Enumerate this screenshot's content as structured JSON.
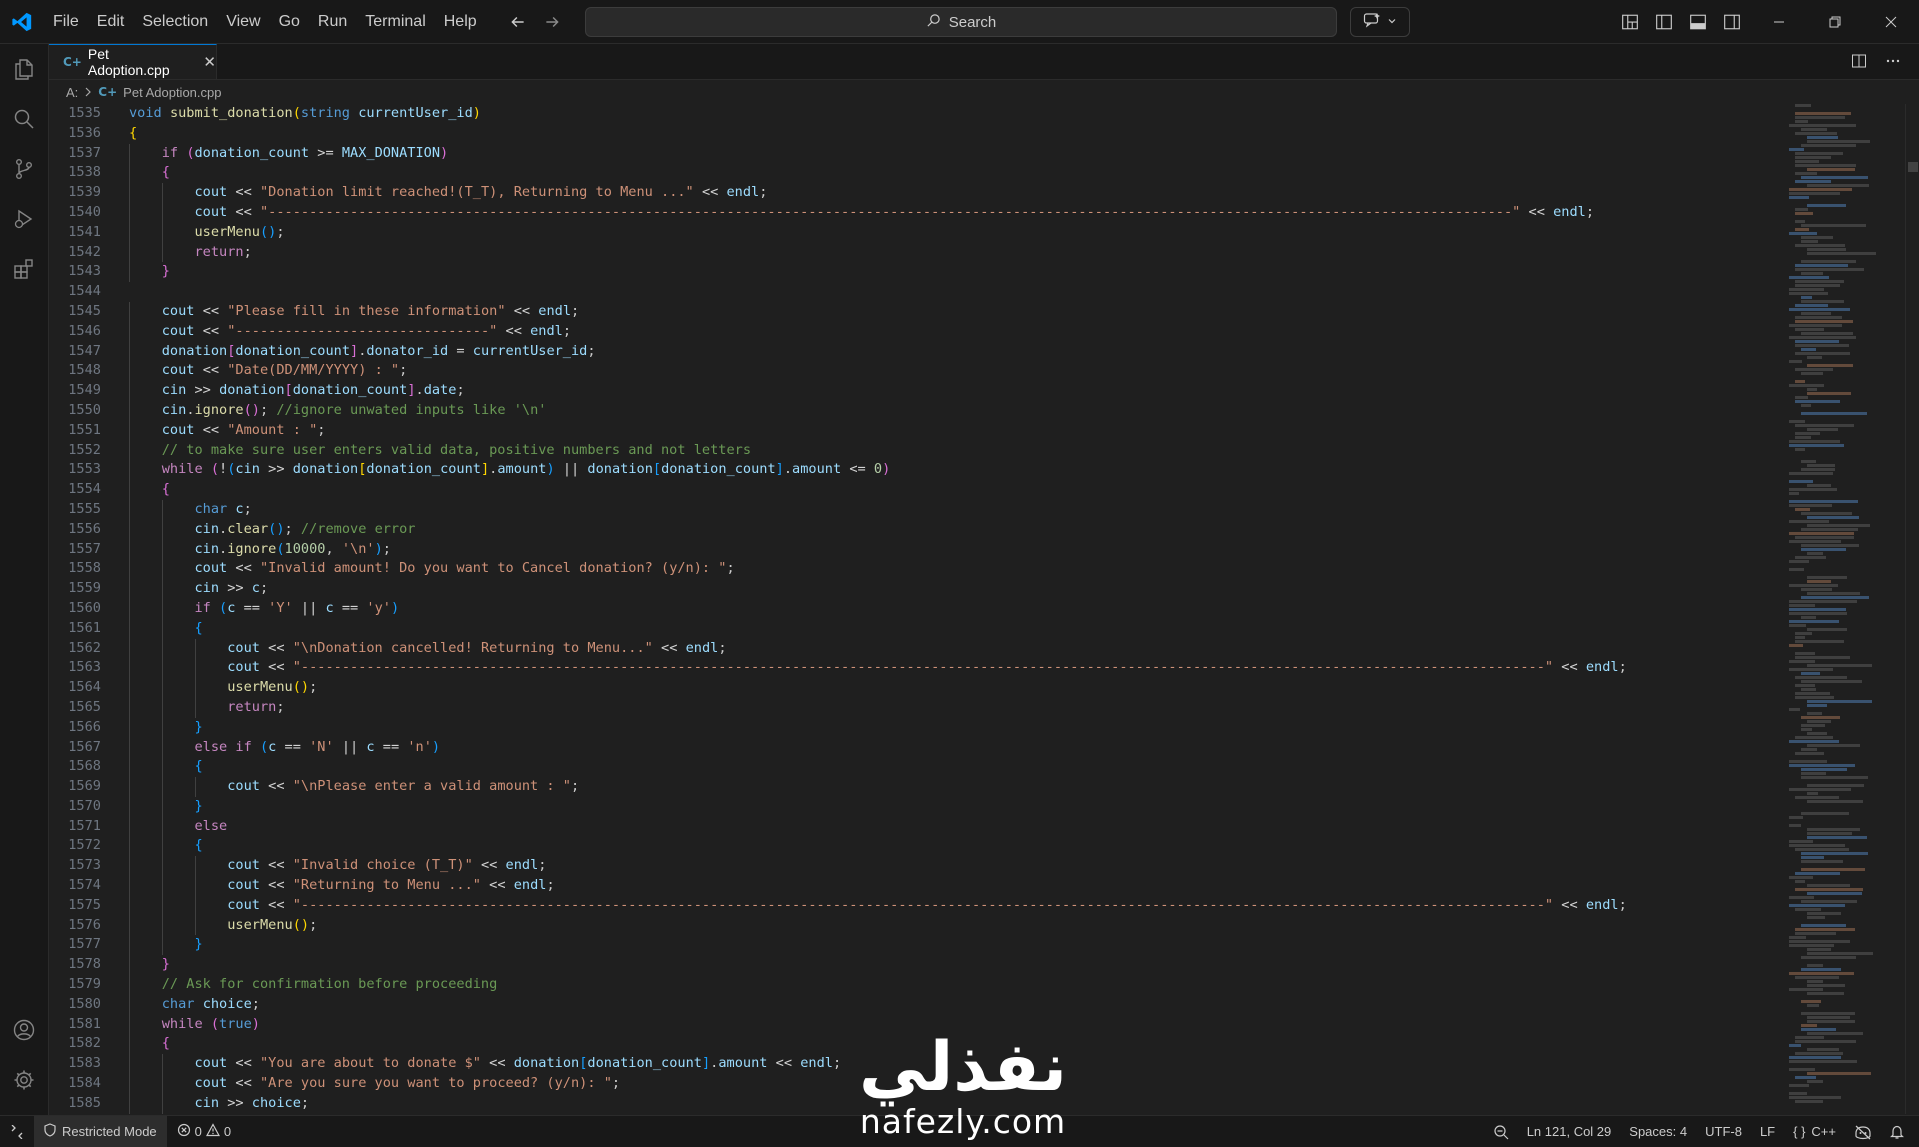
{
  "menu": [
    "File",
    "Edit",
    "Selection",
    "View",
    "Go",
    "Run",
    "Terminal",
    "Help"
  ],
  "search": {
    "label": "Search"
  },
  "tab": {
    "label": "Pet Adoption.cpp",
    "icon": "cpp-file-icon",
    "glyph": "C+"
  },
  "breadcrumb": {
    "root": "A:",
    "file": "Pet Adoption.cpp"
  },
  "colors": {
    "accent": "#0078d4",
    "editor_bg": "#1f1f1f",
    "chrome_bg": "#181818"
  },
  "code": {
    "lines": [
      {
        "n": "1535",
        "html": "<span class=\"kw\">void</span> <span class=\"fn\">submit_donation</span><span class=\"br3\">(</span><span class=\"kw\">string</span> <span class=\"var\">currentUser_id</span><span class=\"br3\">)</span>"
      },
      {
        "n": "1536",
        "html": "<span class=\"br3\">{</span>"
      },
      {
        "n": "1537",
        "html": "    <span class=\"ctl\">if</span> <span class=\"br2\">(</span><span class=\"var\">donation_count</span> <span class=\"op\">&gt;=</span> <span class=\"var\">MAX_DONATION</span><span class=\"br2\">)</span>"
      },
      {
        "n": "1538",
        "html": "    <span class=\"br2\">{</span>"
      },
      {
        "n": "1539",
        "html": "        <span class=\"var\">cout</span> <span class=\"op\">&lt;&lt;</span> <span class=\"str\">\"Donation limit reached!(T_T), Returning to Menu ...\"</span> <span class=\"op\">&lt;&lt;</span> <span class=\"var\">endl</span>;"
      },
      {
        "n": "1540",
        "html": "        <span class=\"var\">cout</span> <span class=\"op\">&lt;&lt;</span> <span class=\"str\">\"--------------------------------------------------------------------------------------------------------------------------------------------------------\"</span> <span class=\"op\">&lt;&lt;</span> <span class=\"var\">endl</span>;"
      },
      {
        "n": "1541",
        "html": "        <span class=\"fn\">userMenu</span><span class=\"br\">()</span>;"
      },
      {
        "n": "1542",
        "html": "        <span class=\"ctl\">return</span>;"
      },
      {
        "n": "1543",
        "html": "    <span class=\"br2\">}</span>"
      },
      {
        "n": "1544",
        "html": ""
      },
      {
        "n": "1545",
        "html": "    <span class=\"var\">cout</span> <span class=\"op\">&lt;&lt;</span> <span class=\"str\">\"Please fill in these information\"</span> <span class=\"op\">&lt;&lt;</span> <span class=\"var\">endl</span>;"
      },
      {
        "n": "1546",
        "html": "    <span class=\"var\">cout</span> <span class=\"op\">&lt;&lt;</span> <span class=\"str\">\"-------------------------------\"</span> <span class=\"op\">&lt;&lt;</span> <span class=\"var\">endl</span>;"
      },
      {
        "n": "1547",
        "html": "    <span class=\"var\">donation</span><span class=\"br2\">[</span><span class=\"var\">donation_count</span><span class=\"br2\">]</span>.<span class=\"var\">donator_id</span> <span class=\"op\">=</span> <span class=\"var\">currentUser_id</span>;"
      },
      {
        "n": "1548",
        "html": "    <span class=\"var\">cout</span> <span class=\"op\">&lt;&lt;</span> <span class=\"str\">\"Date(DD/MM/YYYY) : \"</span>;"
      },
      {
        "n": "1549",
        "html": "    <span class=\"var\">cin</span> <span class=\"op\">&gt;&gt;</span> <span class=\"var\">donation</span><span class=\"br2\">[</span><span class=\"var\">donation_count</span><span class=\"br2\">]</span>.<span class=\"var\">date</span>;"
      },
      {
        "n": "1550",
        "html": "    <span class=\"var\">cin</span>.<span class=\"fn\">ignore</span><span class=\"br2\">()</span>; <span class=\"cmt\">//ignore unwated inputs like '\\n'</span>"
      },
      {
        "n": "1551",
        "html": "    <span class=\"var\">cout</span> <span class=\"op\">&lt;&lt;</span> <span class=\"str\">\"Amount : \"</span>;"
      },
      {
        "n": "1552",
        "html": "    <span class=\"cmt\">// to make sure user enters valid data, positive numbers and not letters</span>"
      },
      {
        "n": "1553",
        "html": "    <span class=\"ctl\">while</span> <span class=\"br2\">(</span><span class=\"op\">!</span><span class=\"br\">(</span><span class=\"var\">cin</span> <span class=\"op\">&gt;&gt;</span> <span class=\"var\">donation</span><span class=\"br3\">[</span><span class=\"var\">donation_count</span><span class=\"br3\">]</span>.<span class=\"var\">amount</span><span class=\"br\">)</span> <span class=\"op\">||</span> <span class=\"var\">donation</span><span class=\"br\">[</span><span class=\"var\">donation_count</span><span class=\"br\">]</span>.<span class=\"var\">amount</span> <span class=\"op\">&lt;=</span> <span class=\"num\">0</span><span class=\"br2\">)</span>"
      },
      {
        "n": "1554",
        "html": "    <span class=\"br2\">{</span>"
      },
      {
        "n": "1555",
        "html": "        <span class=\"kw\">char</span> <span class=\"var\">c</span>;"
      },
      {
        "n": "1556",
        "html": "        <span class=\"var\">cin</span>.<span class=\"fn\">clear</span><span class=\"br\">()</span>; <span class=\"cmt\">//remove error</span>"
      },
      {
        "n": "1557",
        "html": "        <span class=\"var\">cin</span>.<span class=\"fn\">ignore</span><span class=\"br\">(</span><span class=\"num\">10000</span>, <span class=\"str\">'\\n'</span><span class=\"br\">)</span>;"
      },
      {
        "n": "1558",
        "html": "        <span class=\"var\">cout</span> <span class=\"op\">&lt;&lt;</span> <span class=\"str\">\"Invalid amount! Do you want to Cancel donation? (y/n): \"</span>;"
      },
      {
        "n": "1559",
        "html": "        <span class=\"var\">cin</span> <span class=\"op\">&gt;&gt;</span> <span class=\"var\">c</span>;"
      },
      {
        "n": "1560",
        "html": "        <span class=\"ctl\">if</span> <span class=\"br\">(</span><span class=\"var\">c</span> <span class=\"op\">==</span> <span class=\"str\">'Y'</span> <span class=\"op\">||</span> <span class=\"var\">c</span> <span class=\"op\">==</span> <span class=\"str\">'y'</span><span class=\"br\">)</span>"
      },
      {
        "n": "1561",
        "html": "        <span class=\"br\">{</span>"
      },
      {
        "n": "1562",
        "html": "            <span class=\"var\">cout</span> <span class=\"op\">&lt;&lt;</span> <span class=\"str\">\"\\nDonation cancelled! Returning to Menu...\"</span> <span class=\"op\">&lt;&lt;</span> <span class=\"var\">endl</span>;"
      },
      {
        "n": "1563",
        "html": "            <span class=\"var\">cout</span> <span class=\"op\">&lt;&lt;</span> <span class=\"str\">\"--------------------------------------------------------------------------------------------------------------------------------------------------------\"</span> <span class=\"op\">&lt;&lt;</span> <span class=\"var\">endl</span>;"
      },
      {
        "n": "1564",
        "html": "            <span class=\"fn\">userMenu</span><span class=\"br3\">()</span>;"
      },
      {
        "n": "1565",
        "html": "            <span class=\"ctl\">return</span>;"
      },
      {
        "n": "1566",
        "html": "        <span class=\"br\">}</span>"
      },
      {
        "n": "1567",
        "html": "        <span class=\"ctl\">else</span> <span class=\"ctl\">if</span> <span class=\"br\">(</span><span class=\"var\">c</span> <span class=\"op\">==</span> <span class=\"str\">'N'</span> <span class=\"op\">||</span> <span class=\"var\">c</span> <span class=\"op\">==</span> <span class=\"str\">'n'</span><span class=\"br\">)</span>"
      },
      {
        "n": "1568",
        "html": "        <span class=\"br\">{</span>"
      },
      {
        "n": "1569",
        "html": "            <span class=\"var\">cout</span> <span class=\"op\">&lt;&lt;</span> <span class=\"str\">\"\\nPlease enter a valid amount : \"</span>;"
      },
      {
        "n": "1570",
        "html": "        <span class=\"br\">}</span>"
      },
      {
        "n": "1571",
        "html": "        <span class=\"ctl\">else</span>"
      },
      {
        "n": "1572",
        "html": "        <span class=\"br\">{</span>"
      },
      {
        "n": "1573",
        "html": "            <span class=\"var\">cout</span> <span class=\"op\">&lt;&lt;</span> <span class=\"str\">\"Invalid choice (T_T)\"</span> <span class=\"op\">&lt;&lt;</span> <span class=\"var\">endl</span>;"
      },
      {
        "n": "1574",
        "html": "            <span class=\"var\">cout</span> <span class=\"op\">&lt;&lt;</span> <span class=\"str\">\"Returning to Menu ...\"</span> <span class=\"op\">&lt;&lt;</span> <span class=\"var\">endl</span>;"
      },
      {
        "n": "1575",
        "html": "            <span class=\"var\">cout</span> <span class=\"op\">&lt;&lt;</span> <span class=\"str\">\"--------------------------------------------------------------------------------------------------------------------------------------------------------\"</span> <span class=\"op\">&lt;&lt;</span> <span class=\"var\">endl</span>;"
      },
      {
        "n": "1576",
        "html": "            <span class=\"fn\">userMenu</span><span class=\"br3\">()</span>;"
      },
      {
        "n": "1577",
        "html": "        <span class=\"br\">}</span>"
      },
      {
        "n": "1578",
        "html": "    <span class=\"br2\">}</span>"
      },
      {
        "n": "1579",
        "html": "    <span class=\"cmt\">// Ask for confirmation before proceeding</span>"
      },
      {
        "n": "1580",
        "html": "    <span class=\"kw\">char</span> <span class=\"var\">choice</span>;"
      },
      {
        "n": "1581",
        "html": "    <span class=\"ctl\">while</span> <span class=\"br2\">(</span><span class=\"kw\">true</span><span class=\"br2\">)</span>"
      },
      {
        "n": "1582",
        "html": "    <span class=\"br2\">{</span>"
      },
      {
        "n": "1583",
        "html": "        <span class=\"var\">cout</span> <span class=\"op\">&lt;&lt;</span> <span class=\"str\">\"You are about to donate $\"</span> <span class=\"op\">&lt;&lt;</span> <span class=\"var\">donation</span><span class=\"br\">[</span><span class=\"var\">donation_count</span><span class=\"br\">]</span>.<span class=\"var\">amount</span> <span class=\"op\">&lt;&lt;</span> <span class=\"var\">endl</span>;"
      },
      {
        "n": "1584",
        "html": "        <span class=\"var\">cout</span> <span class=\"op\">&lt;&lt;</span> <span class=\"str\">\"Are you sure you want to proceed? (y/n): \"</span>;"
      },
      {
        "n": "1585",
        "html": "        <span class=\"var\">cin</span> <span class=\"op\">&gt;&gt;</span> <span class=\"var\">choice</span>;"
      }
    ]
  },
  "status": {
    "restricted": "Restricted Mode",
    "errors": "0",
    "warnings": "0",
    "position": "Ln 121, Col 29",
    "spaces": "Spaces: 4",
    "encoding": "UTF-8",
    "eol": "LF",
    "language": "C++"
  },
  "watermark": {
    "arabic": "نفذلي",
    "latin": "nafezly.com"
  }
}
